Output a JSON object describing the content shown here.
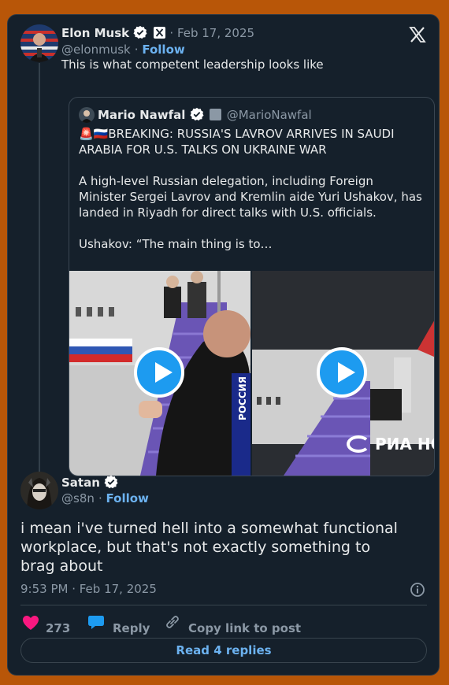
{
  "post": {
    "author_name": "Elon Musk",
    "handle": "@elonmusk",
    "date": "Feb 17, 2025",
    "follow_label": "Follow",
    "text": "This is what competent leadership looks like"
  },
  "quoted": {
    "author_name": "Mario Nawfal",
    "handle": "@MarioNawfal",
    "line1": "🚨🇷🇺BREAKING: RUSSIA'S LAVROV ARRIVES IN SAUDI",
    "line2": "ARABIA FOR U.S. TALKS ON UKRAINE WAR",
    "line3": "A high-level Russian delegation, including Foreign",
    "line4": "Minister Sergei Lavrov and Kremlin aide Yuri Ushakov, has",
    "line5": "landed in Riyadh for direct talks with U.S. officials.",
    "line6": "Ushakov: “The main thing is to…",
    "media_left_mic_text": "РОССИЯ",
    "media_right_watermark": "РИА НО"
  },
  "reply": {
    "author_name": "Satan",
    "handle": "@s8n",
    "follow_label": "Follow",
    "line1": "i mean i've turned hell into a somewhat functional",
    "line2": "workplace, but that's not exactly something to",
    "line3": "brag about",
    "timestamp": "9:53 PM · Feb 17, 2025"
  },
  "actions": {
    "likes": "273",
    "reply_label": "Reply",
    "copy_label": "Copy link to post",
    "read_replies_label": "Read 4 replies"
  },
  "colors": {
    "background": "#b85608",
    "card": "#15202b",
    "accent": "#1d9bf0",
    "link": "#6cb2f0",
    "like": "#f91880"
  },
  "icons": [
    "verified-badge-icon",
    "x-logo-icon",
    "close-x-icon",
    "play-icon",
    "info-icon",
    "heart-icon",
    "reply-bubble-icon",
    "link-icon"
  ]
}
